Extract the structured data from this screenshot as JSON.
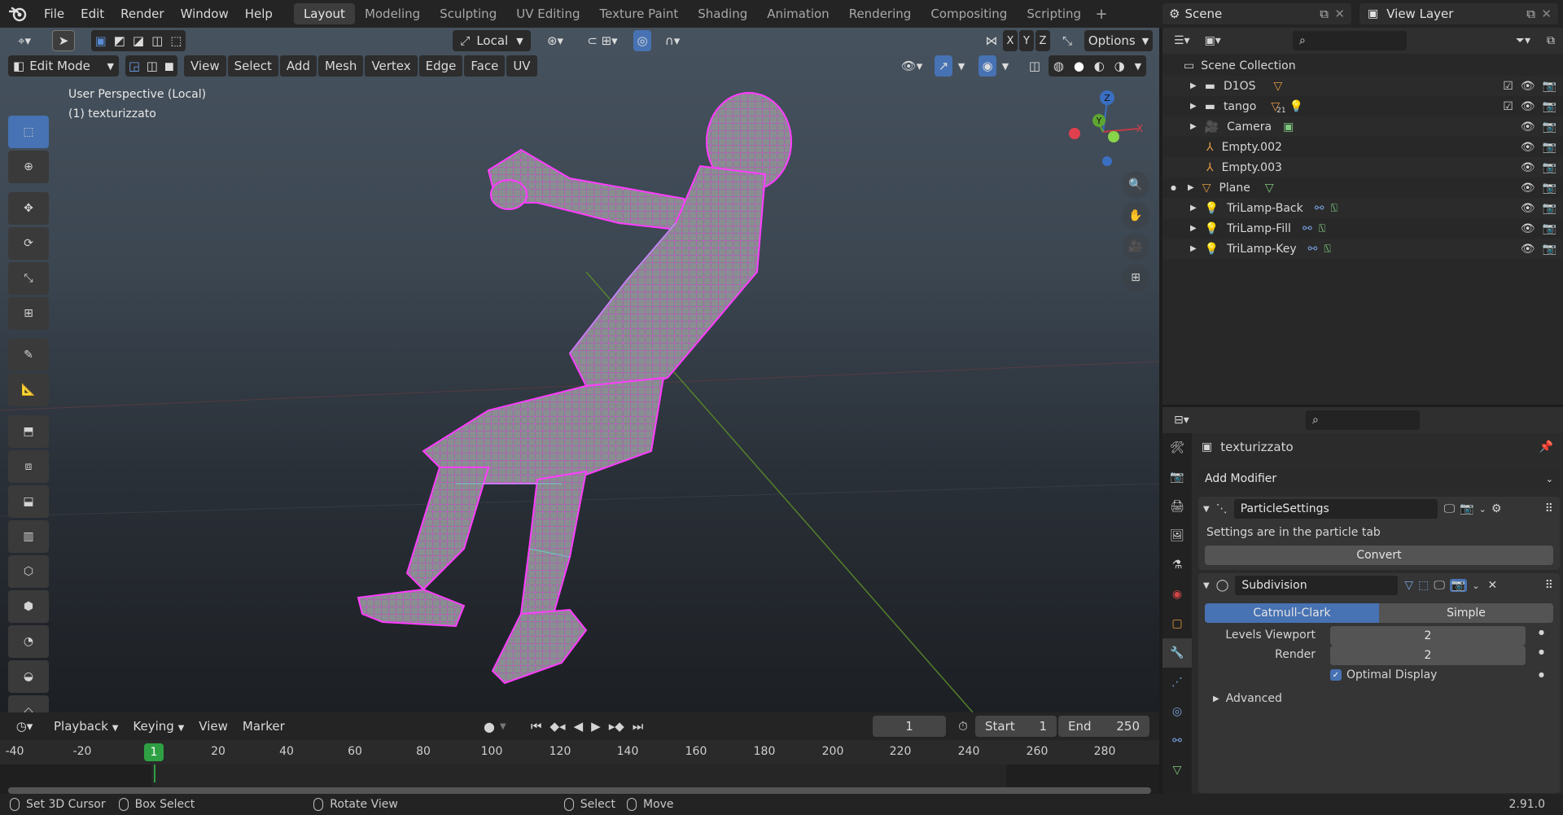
{
  "topbar": {
    "menus": [
      "File",
      "Edit",
      "Render",
      "Window",
      "Help"
    ],
    "workspaces": [
      "Layout",
      "Modeling",
      "Sculpting",
      "UV Editing",
      "Texture Paint",
      "Shading",
      "Animation",
      "Rendering",
      "Compositing",
      "Scripting"
    ],
    "active_workspace": "Layout",
    "scene_name": "Scene",
    "view_layer": "View Layer"
  },
  "viewport": {
    "orientation": "Local",
    "options_label": "Options",
    "mode": "Edit Mode",
    "header_menus": [
      "View",
      "Select",
      "Add",
      "Mesh",
      "Vertex",
      "Edge",
      "Face",
      "UV"
    ],
    "axis_labels": [
      "X",
      "Y",
      "Z"
    ],
    "overlay_line1": "User Perspective (Local)",
    "overlay_line2": "(1) texturizzato",
    "gizmo": {
      "z": "Z",
      "y": "Y",
      "x": "X"
    }
  },
  "timeline": {
    "menus": [
      "Playback",
      "Keying",
      "View",
      "Marker"
    ],
    "current_frame": "1",
    "start_label": "Start",
    "start": "1",
    "end_label": "End",
    "end": "250",
    "ruler": [
      "-40",
      "-20",
      "1",
      "20",
      "40",
      "60",
      "80",
      "100",
      "120",
      "140",
      "160",
      "180",
      "200",
      "220",
      "240",
      "260",
      "280"
    ]
  },
  "statusbar": {
    "items": [
      "Set 3D Cursor",
      "Box Select",
      "Rotate View",
      "Select",
      "Move"
    ],
    "version": "2.91.0"
  },
  "outliner": {
    "root": "Scene Collection",
    "rows": [
      {
        "name": "D1OS",
        "type": "collection"
      },
      {
        "name": "tango",
        "type": "collection"
      },
      {
        "name": "Camera",
        "type": "camera"
      },
      {
        "name": "Empty.002",
        "type": "empty"
      },
      {
        "name": "Empty.003",
        "type": "empty"
      },
      {
        "name": "Plane",
        "type": "mesh"
      },
      {
        "name": "TriLamp-Back",
        "type": "light"
      },
      {
        "name": "TriLamp-Fill",
        "type": "light"
      },
      {
        "name": "TriLamp-Key",
        "type": "light"
      }
    ],
    "badge_count": "21"
  },
  "properties": {
    "object_name": "texturizzato",
    "add_modifier": "Add Modifier",
    "particle": {
      "name": "ParticleSettings",
      "info": "Settings are in the particle tab",
      "convert": "Convert"
    },
    "subdivision": {
      "name": "Subdivision",
      "mode_a": "Catmull-Clark",
      "mode_b": "Simple",
      "levels_viewport_label": "Levels Viewport",
      "levels_viewport": "2",
      "render_label": "Render",
      "render": "2",
      "optimal_display": "Optimal Display",
      "advanced": "Advanced"
    }
  },
  "colors": {
    "accent": "#4772b3",
    "vertex_select": "#ff3dff",
    "edge_cyan": "#5fe8d8",
    "frame_marker": "#2ea043"
  }
}
